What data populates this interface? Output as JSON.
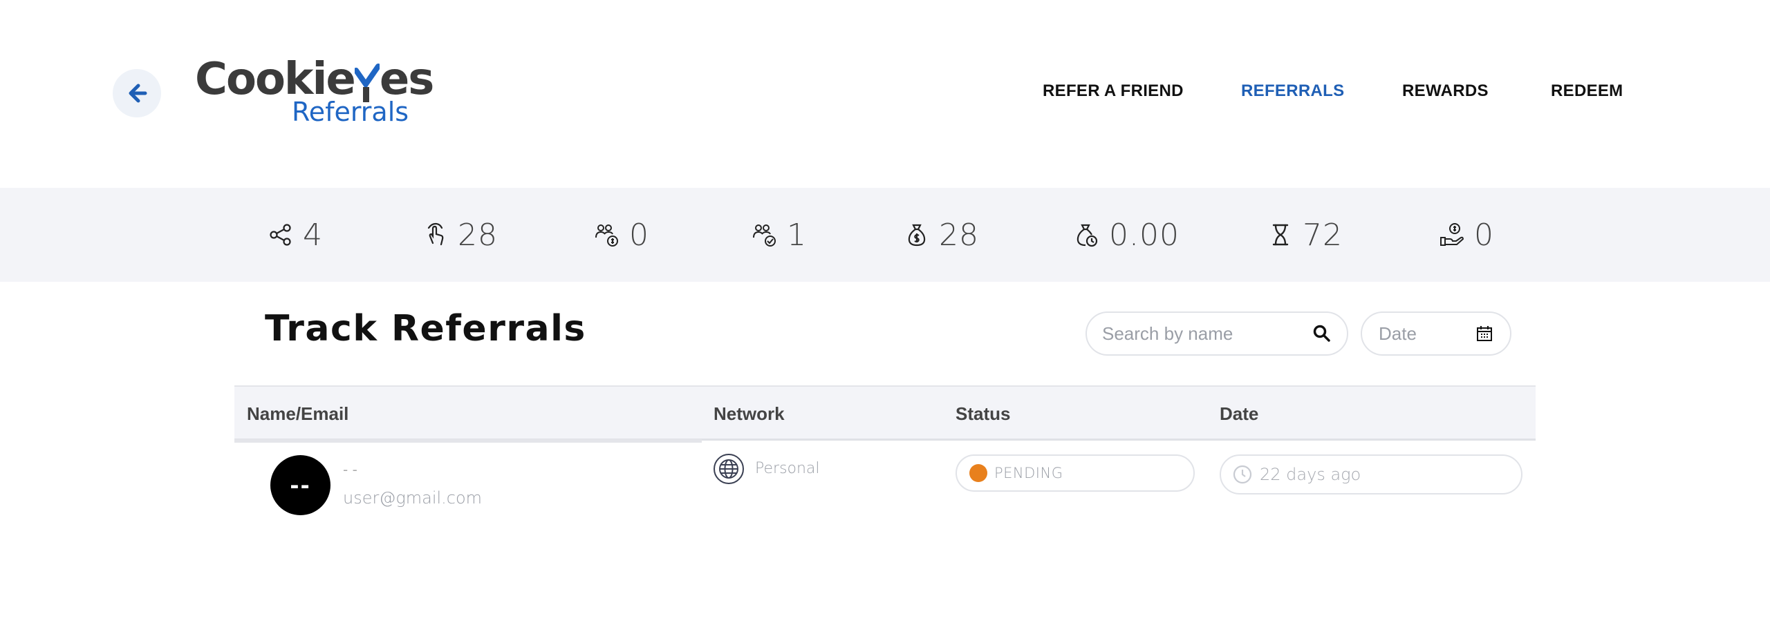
{
  "brand": {
    "name_part1": "Cookie",
    "name_y": "Y",
    "name_part2": "es",
    "subtitle": "Referrals",
    "accent": "#1f66c4"
  },
  "nav": {
    "items": [
      {
        "label": "REFER A FRIEND",
        "active": false
      },
      {
        "label": "REFERRALS",
        "active": true
      },
      {
        "label": "REWARDS",
        "active": false
      },
      {
        "label": "REDEEM",
        "active": false
      }
    ]
  },
  "stats": [
    {
      "icon": "share-icon",
      "value": "4"
    },
    {
      "icon": "click-icon",
      "value": "28"
    },
    {
      "icon": "users-money-icon",
      "value": "0"
    },
    {
      "icon": "users-check-icon",
      "value": "1"
    },
    {
      "icon": "money-bag-icon",
      "value": "28"
    },
    {
      "icon": "money-bag-clock-icon",
      "value": "0.00"
    },
    {
      "icon": "hourglass-icon",
      "value": "72"
    },
    {
      "icon": "hand-coin-icon",
      "value": "0"
    }
  ],
  "page": {
    "title": "Track Referrals",
    "search_placeholder": "Search by name",
    "date_placeholder": "Date"
  },
  "table": {
    "columns": [
      "Name/Email",
      "Network",
      "Status",
      "Date"
    ],
    "rows": [
      {
        "avatar_initials": "--",
        "name": "- -",
        "email": "user@gmail.com",
        "network": "Personal",
        "status": "PENDING",
        "status_color": "#e8801d",
        "date": "22 days ago"
      }
    ]
  }
}
